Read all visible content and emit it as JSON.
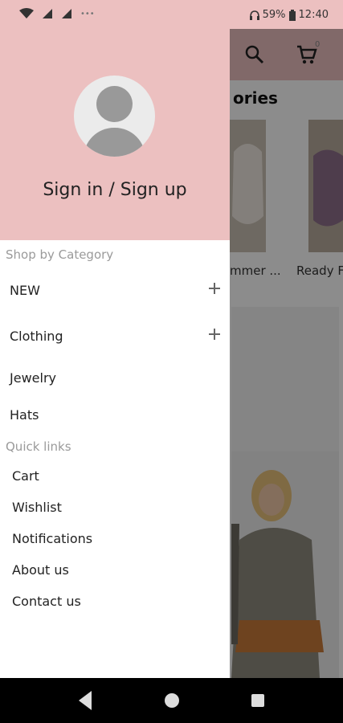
{
  "status_bar": {
    "battery": "59%",
    "time": "12:40",
    "icons": [
      "wifi-icon",
      "signal-icon",
      "signal-icon",
      "more-icon",
      "headphones-icon",
      "battery-icon"
    ]
  },
  "background_app": {
    "section_title": "ories",
    "categories": [
      {
        "label": "mmer ..."
      },
      {
        "label": "Ready Fo"
      }
    ],
    "cart_count": "0"
  },
  "drawer": {
    "sign_in_label": "Sign in / Sign up",
    "shop_by_category_label": "Shop by Category",
    "categories": [
      {
        "label": "NEW",
        "expandable": true
      },
      {
        "label": "Clothing",
        "expandable": true
      },
      {
        "label": "Jewelry",
        "expandable": false
      },
      {
        "label": "Hats",
        "expandable": false
      }
    ],
    "quick_links_label": "Quick links",
    "quick_links": [
      {
        "label": "Cart"
      },
      {
        "label": "Wishlist"
      },
      {
        "label": "Notifications"
      },
      {
        "label": "About us"
      },
      {
        "label": "Contact us"
      }
    ]
  },
  "colors": {
    "accent": "#ecc0c0",
    "nav_bar": "#000000",
    "overlay": "rgba(0,0,0,0.45)"
  }
}
